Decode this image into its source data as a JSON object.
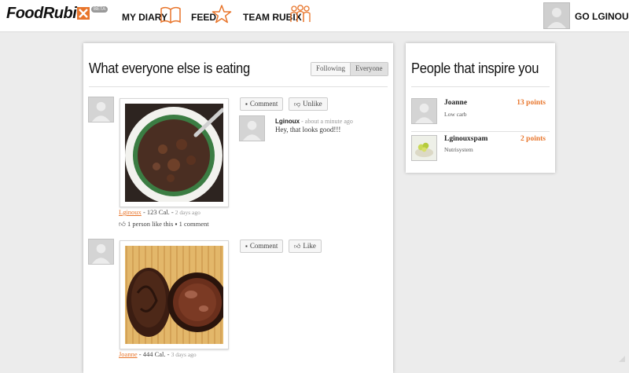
{
  "header": {
    "logo_text": "FoodRubi",
    "beta_badge": "BETA",
    "nav": {
      "my_diary": "MY DIARY",
      "feed": "FEED",
      "team_rubix": "TEAM RUBIX"
    },
    "user_menu": "GO LGINOUX"
  },
  "feed": {
    "title": "What everyone else is eating",
    "filter_options": [
      "Following",
      "Everyone"
    ],
    "selected_filter": "Everyone",
    "posts": [
      {
        "user": "Lginoux",
        "calories": " - 123 Cal. - ",
        "time": "2 days ago",
        "likes_text": "1 person like this",
        "comments_text": "1 comment",
        "comment_button": "Comment",
        "like_button": "Unlike",
        "photo_icon": "stew-bowl-photo",
        "comments": [
          {
            "author": "Lginoux",
            "time": " - about a minute ago",
            "text": "Hey, that looks good!!!"
          }
        ]
      },
      {
        "user": "Joanne",
        "calories": " - 444 Cal. - ",
        "time": "3 days ago",
        "comment_button": "Comment",
        "like_button": "Like",
        "photo_icon": "chocolate-cups-photo"
      }
    ]
  },
  "sidebar": {
    "title": "People that inspire you",
    "people": [
      {
        "name": "Joanne",
        "subtitle": "Low carb",
        "points": "13 points"
      },
      {
        "name": "Lginouxspam",
        "subtitle": "Nutrisystem",
        "points": "2 points"
      }
    ]
  },
  "colors": {
    "accent": "#e8752b",
    "background": "#ececec",
    "panel": "#ffffff"
  }
}
